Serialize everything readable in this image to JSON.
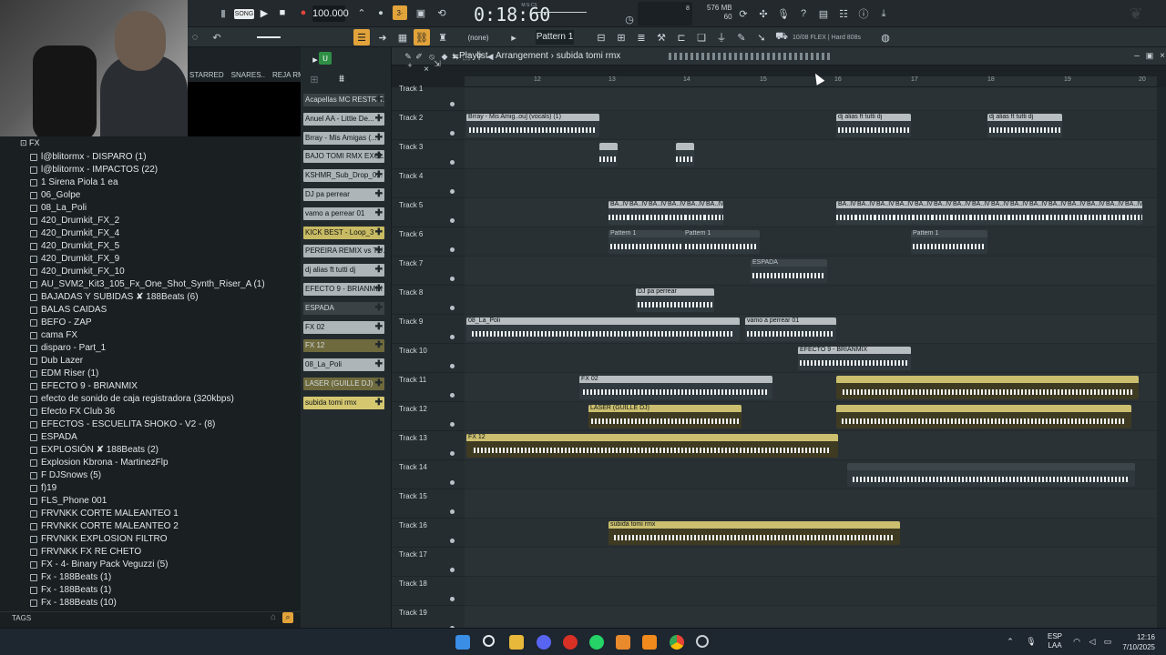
{
  "topbar": {
    "song_label": "SONG",
    "bpm": "100.000",
    "time": "0:18:60",
    "time_unit": "M:S:CS",
    "ram": "576 MB",
    "ram2": "60",
    "counter": "8"
  },
  "toolbar2": {
    "none_label": "(none)",
    "pattern": "Pattern 1",
    "hint": "10/08 FLEX | Hard 808s"
  },
  "browser": {
    "root": "FX",
    "tabs": [
      "STARRED",
      "SNARES..",
      "REJA RMX"
    ],
    "items": [
      "l@blitormx - DISPARO (1)",
      "l@blitormx - IMPACTOS (22)",
      "1 Sirena Piola 1 ea",
      "06_Golpe",
      "08_La_Poli",
      "420_Drumkit_FX_2",
      "420_Drumkit_FX_4",
      "420_Drumkit_FX_5",
      "420_Drumkit_FX_9",
      "420_Drumkit_FX_10",
      "AU_SVM2_Kit3_105_Fx_One_Shot_Synth_Riser_A (1)",
      "BAJADAS Y SUBIDAS ✘ 188Beats (6)",
      "BALAS CAIDAS",
      "BEFO - ZAP",
      "cama FX",
      "disparo - Part_1",
      "Dub Lazer",
      "EDM Riser (1)",
      "EFECTO 9 - BRIANMIX",
      "efecto de sonido de caja registradora (320kbps)",
      "Efecto FX Club 36",
      "EFECTOS - ESCUELITA SHOKO - V2 -  (8)",
      "ESPADA",
      "EXPLOSIÓN ✘ 188Beats (2)",
      "Explosion Kbrona - MartinezFlp",
      "F DJSnows (5)",
      "f)19",
      "FLS_Phone 001",
      "FRVNKK CORTE MALEANTEO 1",
      "FRVNKK CORTE MALEANTEO 2",
      "FRVNKK EXPLOSION FILTRO",
      "FRVNKK FX RE CHETO",
      "FX - 4- Binary Pack Veguzzi (5)",
      "Fx - 188Beats (1)",
      "Fx - 188Beats (1)",
      "Fx - 188Beats (10)"
    ],
    "tags_label": "TAGS"
  },
  "channels": [
    {
      "name": "Acapellas MC RESTRIT...",
      "color": "#3a4246"
    },
    {
      "name": "Anuel AA - Little De...",
      "color": "#aeb5b9"
    },
    {
      "name": "Brray - Mis Amigas (...",
      "color": "#aeb5b9"
    },
    {
      "name": "BAJO TOMI RMX EXCL...",
      "color": "#aeb5b9"
    },
    {
      "name": "KSHMR_Sub_Drop_0...",
      "color": "#aeb5b9"
    },
    {
      "name": "DJ pa perrear",
      "color": "#aeb5b9"
    },
    {
      "name": "vamo a perrear 01",
      "color": "#aeb5b9"
    },
    {
      "name": "KICK BEST - Loop_3",
      "color": "#c9bb63"
    },
    {
      "name": "PEREIRA REMIX vs TU...",
      "color": "#aeb5b9"
    },
    {
      "name": "dj alias ft tutti dj",
      "color": "#aeb5b9"
    },
    {
      "name": "EFECTO 9 - BRIANMIX",
      "color": "#aeb5b9"
    },
    {
      "name": "ESPADA",
      "color": "#3a4246"
    },
    {
      "name": "FX 02",
      "color": "#aeb5b9"
    },
    {
      "name": "FX 12",
      "color": "#6e6a3d"
    },
    {
      "name": "08_La_Poli",
      "color": "#aeb5b9"
    },
    {
      "name": "LASER (GUILLE DJ)",
      "color": "#6e6a3d"
    },
    {
      "name": "subida tomi rmx",
      "color": "#d4c770"
    }
  ],
  "playlist": {
    "title": "Playlist - Arrangement",
    "arrangement": "subida tomi rmx",
    "ruler": [
      "12",
      "13",
      "14",
      "15",
      "16",
      "17",
      "18",
      "19",
      "20"
    ],
    "tracks": [
      "Track 1",
      "Track 2",
      "Track 3",
      "Track 4",
      "Track 5",
      "Track 6",
      "Track 7",
      "Track 8",
      "Track 9",
      "Track 10",
      "Track 11",
      "Track 12",
      "Track 13",
      "Track 14",
      "Track 15",
      "Track 16",
      "Track 17",
      "Track 18",
      "Track 19"
    ],
    "clips": {
      "brray": "Brray - Mis Amig..ou] (vocals) (1)",
      "djalias": "dj alias ft tutti dj",
      "baivo": "BA..IVO",
      "pattern1": "Pattern 1",
      "espada": "ESPADA",
      "djpaperrear": "DJ pa perrear",
      "lapoli": "08_La_Poli",
      "vamoaperrear": "vamo a perrear 01",
      "efecto9": "EFECTO 9 - BRIANMIX",
      "fx02": "FX 02",
      "laser": "LASER (GUILLE DJ)",
      "fx12": "FX 12",
      "subida": "subida tomi rmx"
    }
  },
  "taskbar": {
    "lang": "ESP",
    "lang2": "LAA",
    "time": "12:16",
    "date": "7/10/2025"
  }
}
